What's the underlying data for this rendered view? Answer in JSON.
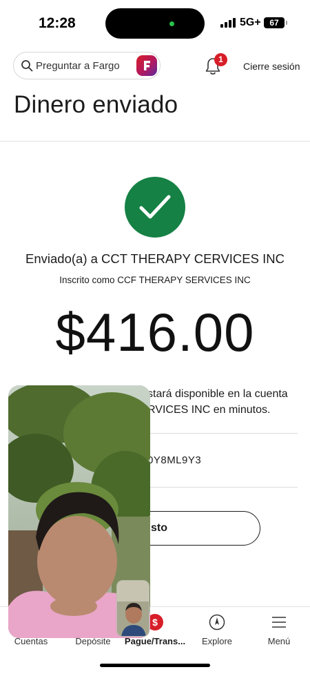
{
  "status_bar": {
    "time": "12:28",
    "network": "5G+",
    "battery": "67"
  },
  "header": {
    "search_placeholder": "Preguntar a Fargo",
    "notification_count": "1",
    "logout_label": "Cierre sesión"
  },
  "page": {
    "title": "Dinero enviado"
  },
  "confirmation": {
    "sent_to": "Enviado(a) a CCT THERAPY CERVICES INC",
    "enrolled_as": "Inscrito como CCF THERAPY SERVICES INC",
    "amount": "$416.00",
    "availability_line1": "stará disponible en la cuenta",
    "availability_line2": "RVICES INC en minutos.",
    "confirmation_code": "0Y8ML9Y3",
    "action_button_label": "sto"
  },
  "bottom_nav": {
    "items": [
      {
        "label": "Cuentas",
        "icon": "accounts-icon"
      },
      {
        "label": "Depósite",
        "icon": "deposit-icon"
      },
      {
        "label": "Pague/Trans...",
        "icon": "pay-transfer-icon",
        "badge": "$"
      },
      {
        "label": "Explore",
        "icon": "compass-icon"
      },
      {
        "label": "Menú",
        "icon": "menu-icon"
      }
    ]
  },
  "colors": {
    "success_green": "#158144",
    "brand_red": "#d71e28"
  }
}
